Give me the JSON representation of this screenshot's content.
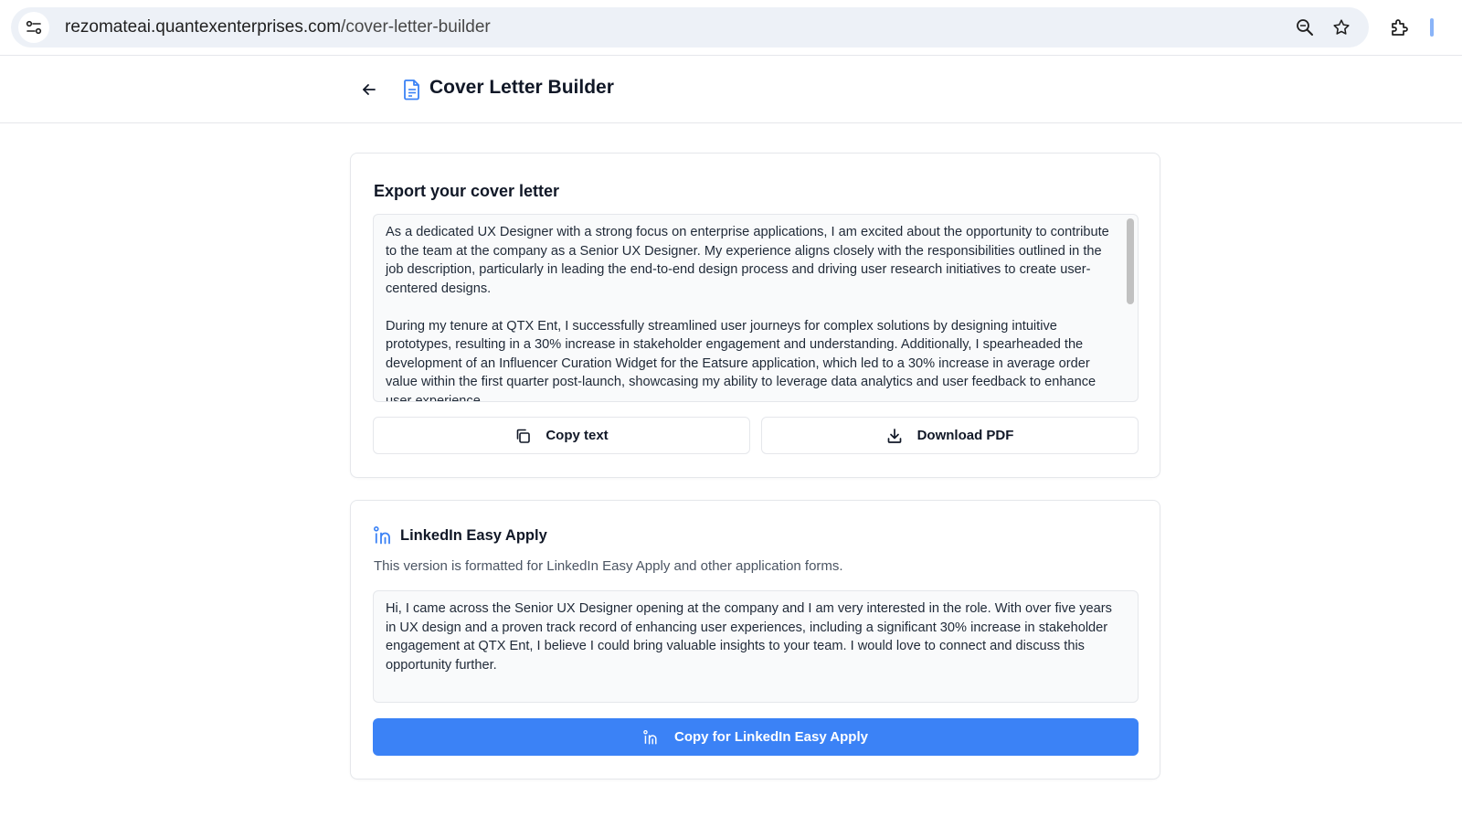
{
  "browser": {
    "url_host": "rezomateai.quantexenterprises.com",
    "url_path": "/cover-letter-builder",
    "icons": [
      "tune-icon",
      "zoom-icon",
      "star-icon",
      "extensions-icon"
    ]
  },
  "header": {
    "title": "Cover Letter Builder",
    "icons": [
      "back-arrow-icon",
      "document-icon"
    ]
  },
  "export": {
    "title": "Export your cover letter",
    "letter_paragraphs": [
      "As a dedicated UX Designer with a strong focus on enterprise applications, I am excited about the opportunity to contribute to the team at the company as a Senior UX Designer. My experience aligns closely with the responsibilities outlined in the job description, particularly in leading the end-to-end design process and driving user research initiatives to create user-centered designs.",
      "During my tenure at QTX Ent, I successfully streamlined user journeys for complex solutions by designing intuitive prototypes, resulting in a 30% increase in stakeholder engagement and understanding. Additionally, I spearheaded the development of an Influencer Curation Widget for the Eatsure application, which led to a 30% increase in average order value within the first quarter post-launch, showcasing my ability to leverage data analytics and user feedback to enhance user experience."
    ],
    "copy_label": "Copy text",
    "download_label": "Download PDF"
  },
  "linkedin": {
    "title": "LinkedIn Easy Apply",
    "description": "This version is formatted for LinkedIn Easy Apply and other application forms.",
    "message": "Hi, I came across the Senior UX Designer opening at the company and I am very interested in the role. With over five years in UX design and a proven track record of enhancing user experiences, including a significant 30% increase in stakeholder engagement at QTX Ent, I believe I could bring valuable insights to your team. I would love to connect and discuss this opportunity further.",
    "copy_label": "Copy for LinkedIn Easy Apply"
  },
  "colors": {
    "accent": "#3b82f6",
    "border": "#e5e7eb",
    "textbox_bg": "#f9fafb"
  }
}
